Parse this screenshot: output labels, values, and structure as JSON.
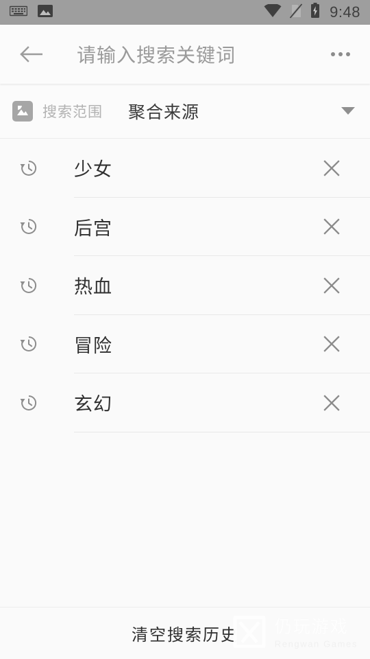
{
  "statusbar": {
    "left_icons": [
      {
        "name": "keyboard-icon",
        "label": "keyboard"
      },
      {
        "name": "image-icon",
        "label": "screenshot"
      }
    ],
    "right_icons": [
      {
        "name": "wifi-icon",
        "label": "wifi"
      },
      {
        "name": "no-sim-icon",
        "label": "no-sim"
      },
      {
        "name": "battery-charging-icon",
        "label": "battery-charging"
      }
    ],
    "time": "9:48",
    "background": "#9e9e9e",
    "icon_color": "#3f3f3f"
  },
  "appbar": {
    "back_icon": "arrow-left-icon",
    "search_placeholder": "请输入搜索关键词",
    "search_value": "",
    "overflow_icon": "more-vertical-icon",
    "background": "#fbfbfb",
    "placeholder_color": "#9a9a9a"
  },
  "scope": {
    "icon": "image-placeholder-icon",
    "label": "搜索范围",
    "selected": "聚合来源",
    "caret_icon": "chevron-down-icon",
    "label_color": "#b2b2b2",
    "value_color": "#3a3a3a"
  },
  "history": {
    "item_icon": "history-icon",
    "delete_icon": "close-icon",
    "items": [
      {
        "label": "少女"
      },
      {
        "label": "后宫"
      },
      {
        "label": "热血"
      },
      {
        "label": "冒险"
      },
      {
        "label": "玄幻"
      }
    ]
  },
  "bottom": {
    "clear_label": "清空搜索历史",
    "clear_color": "#2f2f2f"
  },
  "watermark": {
    "mark_icon": "rengwan-logo-icon",
    "cn": "仍玩游戏",
    "en": "Rengwan Games"
  }
}
